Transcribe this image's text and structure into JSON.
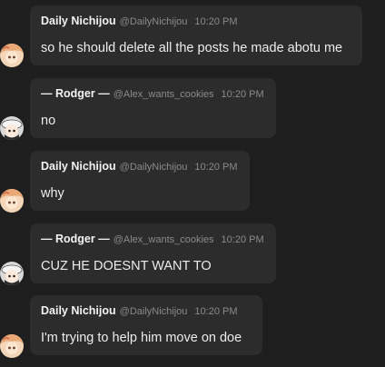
{
  "messages": [
    {
      "author": "Daily Nichijou",
      "handle": "@DailyNichijou",
      "time": "10:20 PM",
      "text": "so he should delete all the posts he made abotu me",
      "avatar_icon": "anime-girl-avatar-icon"
    },
    {
      "author": "— Rodger —",
      "handle": "@Alex_wants_cookies",
      "time": "10:20 PM",
      "text": "no",
      "avatar_icon": "anime-character-avatar-icon"
    },
    {
      "author": "Daily Nichijou",
      "handle": "@DailyNichijou",
      "time": "10:20 PM",
      "text": "why",
      "avatar_icon": "anime-girl-avatar-icon"
    },
    {
      "author": "— Rodger —",
      "handle": "@Alex_wants_cookies",
      "time": "10:20 PM",
      "text": "CUZ HE DOESNT WANT TO",
      "avatar_icon": "anime-character-avatar-icon"
    },
    {
      "author": "Daily Nichijou",
      "handle": "@DailyNichijou",
      "time": "10:20 PM",
      "text": "I'm trying to help him move on doe",
      "avatar_icon": "anime-girl-avatar-icon"
    }
  ],
  "colors": {
    "background": "#1e1e1e",
    "bubble": "#2c2c2c",
    "author_text": "#f2f2f2",
    "meta_text": "#8a8a8a",
    "message_text": "#ececec"
  }
}
